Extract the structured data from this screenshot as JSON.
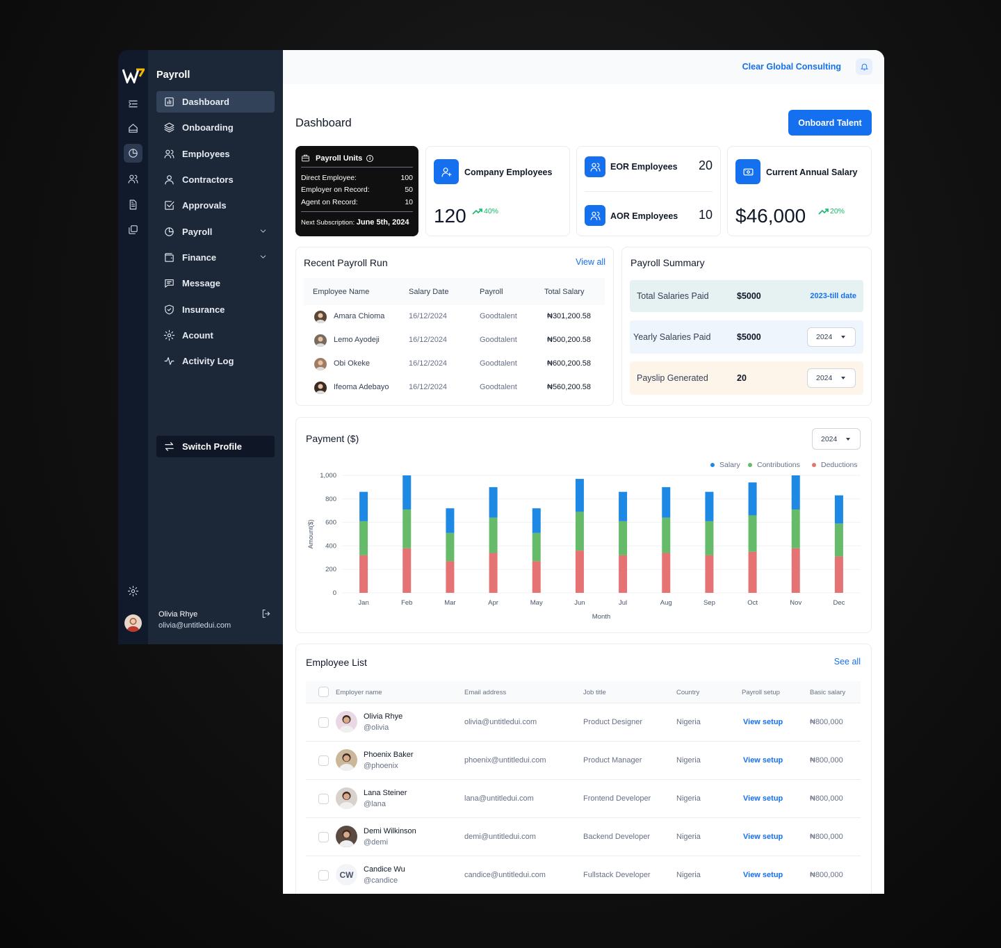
{
  "sidebar": {
    "title": "Payroll",
    "items": [
      {
        "label": "Dashboard",
        "icon": "bar-chart-square-icon"
      },
      {
        "label": "Onboarding",
        "icon": "layers-icon"
      },
      {
        "label": "Employees",
        "icon": "users-icon"
      },
      {
        "label": "Contractors",
        "icon": "user-icon"
      },
      {
        "label": "Approvals",
        "icon": "check-square-icon"
      },
      {
        "label": "Payroll",
        "icon": "pie-chart-icon"
      },
      {
        "label": "Finance",
        "icon": "wallet-icon"
      },
      {
        "label": "Message",
        "icon": "message-icon"
      },
      {
        "label": "Insurance",
        "icon": "shield-icon"
      },
      {
        "label": "Acount",
        "icon": "gear-icon"
      },
      {
        "label": "Activity Log",
        "icon": "activity-icon"
      }
    ],
    "switch_profile": "Switch Profile",
    "user": {
      "name": "Olivia Rhye",
      "email": "olivia@untitledui.com"
    }
  },
  "header": {
    "org": "Clear Global Consulting"
  },
  "page": {
    "title": "Dashboard",
    "primary_button": "Onboard Talent"
  },
  "units": {
    "title": "Payroll Units",
    "rows": [
      {
        "label": "Direct Employee:",
        "value": "100"
      },
      {
        "label": "Employer on Record:",
        "value": "50"
      },
      {
        "label": "Agent on Record:",
        "value": "10"
      }
    ],
    "next_label": "Next Subscription:",
    "next_value": "June 5th, 2024"
  },
  "stats": {
    "company": {
      "label": "Company Employees",
      "value": "120",
      "trend": "40%"
    },
    "eor": {
      "label": "EOR Employees",
      "value": "20"
    },
    "aor": {
      "label": "AOR Employees",
      "value": "10"
    },
    "salary": {
      "label": "Current Annual Salary",
      "value": "$46,000",
      "trend": "20%"
    }
  },
  "recent": {
    "title": "Recent Payroll Run",
    "view_all": "View all",
    "columns": [
      "Employee Name",
      "Salary Date",
      "Payroll",
      "Total Salary"
    ],
    "rows": [
      {
        "name": "Amara Chioma",
        "date": "16/12/2024",
        "payroll": "Goodtalent",
        "total": "₦301,200.58"
      },
      {
        "name": "Lemo Ayodeji",
        "date": "16/12/2024",
        "payroll": "Goodtalent",
        "total": "₦500,200.58"
      },
      {
        "name": "Obi Okeke",
        "date": "16/12/2024",
        "payroll": "Goodtalent",
        "total": "₦600,200.58"
      },
      {
        "name": "Ifeoma Adebayo",
        "date": "16/12/2024",
        "payroll": "Goodtalent",
        "total": "₦560,200.58"
      }
    ]
  },
  "summary": {
    "title": "Payroll Summary",
    "total": {
      "label": "Total Salaries Paid",
      "value": "$5000",
      "link": "2023-till date"
    },
    "yearly": {
      "label": "Yearly Salaries Paid",
      "value": "$5000",
      "select": "2024"
    },
    "payslip": {
      "label": "Payslip Generated",
      "value": "20",
      "select": "2024"
    }
  },
  "payment": {
    "title": "Payment ($)",
    "select": "2024"
  },
  "chart_data": {
    "type": "bar",
    "stacked": true,
    "categories": [
      "Jan",
      "Feb",
      "Mar",
      "Apr",
      "May",
      "Jun",
      "Jul",
      "Aug",
      "Sep",
      "Oct",
      "Nov",
      "Dec"
    ],
    "series": [
      {
        "name": "Deductions",
        "color": "#e57373",
        "values": [
          320,
          380,
          270,
          340,
          270,
          360,
          320,
          340,
          320,
          350,
          380,
          310
        ]
      },
      {
        "name": "Contributions",
        "color": "#66bb6a",
        "values": [
          290,
          330,
          240,
          300,
          240,
          330,
          290,
          300,
          290,
          310,
          330,
          280
        ]
      },
      {
        "name": "Salary",
        "color": "#1e88e5",
        "values": [
          250,
          290,
          210,
          260,
          210,
          280,
          250,
          260,
          250,
          280,
          290,
          240
        ]
      }
    ],
    "ylim": [
      0,
      1000
    ],
    "yticks": [
      "0",
      "200",
      "400",
      "600",
      "800",
      "1,000"
    ],
    "xlabel": "Month",
    "ylabel": "Amount($)",
    "legend_position": "top-right",
    "legend_order": [
      "Salary",
      "Contributions",
      "Deductions"
    ],
    "grid": true
  },
  "employees": {
    "title": "Employee List",
    "see_all": "See all",
    "columns": [
      "Employer name",
      "Email address",
      "Job title",
      "Country",
      "Payroll setup",
      "Basic salary"
    ],
    "rows": [
      {
        "name": "Olivia Rhye",
        "handle": "@olivia",
        "email": "olivia@untitledui.com",
        "job": "Product Designer",
        "country": "Nigeria",
        "setup": "View setup",
        "salary": "₦800,000"
      },
      {
        "name": "Phoenix Baker",
        "handle": "@phoenix",
        "email": "phoenix@untitledui.com",
        "job": "Product Manager",
        "country": "Nigeria",
        "setup": "View setup",
        "salary": "₦800,000"
      },
      {
        "name": "Lana Steiner",
        "handle": "@lana",
        "email": "lana@untitledui.com",
        "job": "Frontend Developer",
        "country": "Nigeria",
        "setup": "View setup",
        "salary": "₦800,000"
      },
      {
        "name": "Demi Wilkinson",
        "handle": "@demi",
        "email": "demi@untitledui.com",
        "job": "Backend Developer",
        "country": "Nigeria",
        "setup": "View setup",
        "salary": "₦800,000"
      },
      {
        "name": "Candice Wu",
        "handle": "@candice",
        "email": "candice@untitledui.com",
        "job": "Fullstack Developer",
        "country": "Nigeria",
        "setup": "View setup",
        "salary": "₦800,000",
        "initials": "CW"
      }
    ]
  }
}
